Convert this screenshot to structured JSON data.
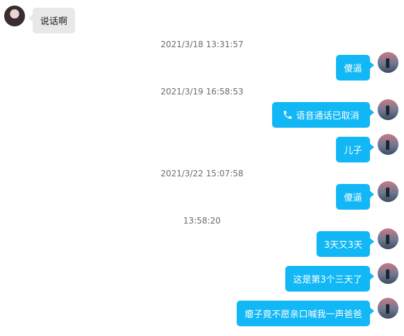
{
  "messages": {
    "m1": "说话啊",
    "m2": "傻逼",
    "m3": "语音通话已取消",
    "m4": "儿子",
    "m5": "傻逼",
    "m6": "3天又3天",
    "m7": "这是第3个三天了",
    "m8": "瘪子竟不愿亲口喊我一声爸爸"
  },
  "timestamps": {
    "t1": "2021/3/18 13:31:57",
    "t2": "2021/3/19 16:58:53",
    "t3": "2021/3/22 15:07:58",
    "t4": "13:58:20"
  },
  "colors": {
    "outgoing_bubble": "#12b7f5",
    "incoming_bubble": "#e8e8e8",
    "timestamp_text": "#6b6b6b"
  },
  "icons": {
    "call": "phone-icon"
  }
}
